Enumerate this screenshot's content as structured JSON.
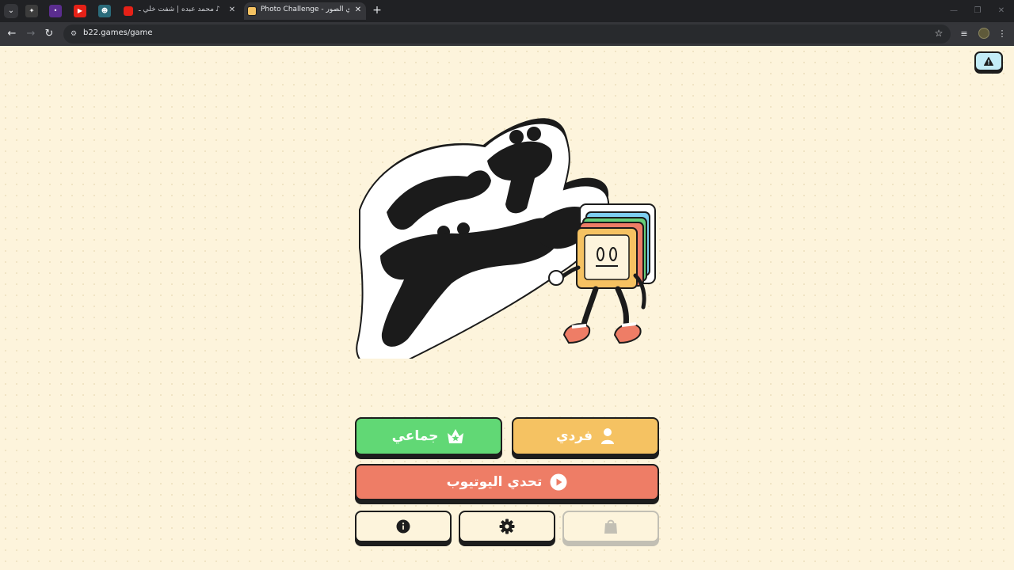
{
  "browser": {
    "tabs": [
      {
        "title": "محمد عبده | شفت خلي ـ يع"
      },
      {
        "title": "Photo Challenge - تحدي الصور"
      }
    ],
    "url": "b22.games/game"
  },
  "game": {
    "title": "تحدي الصور",
    "buttons": {
      "group_label": "جماعي",
      "solo_label": "فردي",
      "youtube_label": "تحدي اليوتيوب"
    },
    "colors": {
      "background": "#fdf4dc",
      "group": "#61d875",
      "solo": "#f5c262",
      "youtube": "#ee7d66",
      "report": "#c3ecf7"
    }
  }
}
